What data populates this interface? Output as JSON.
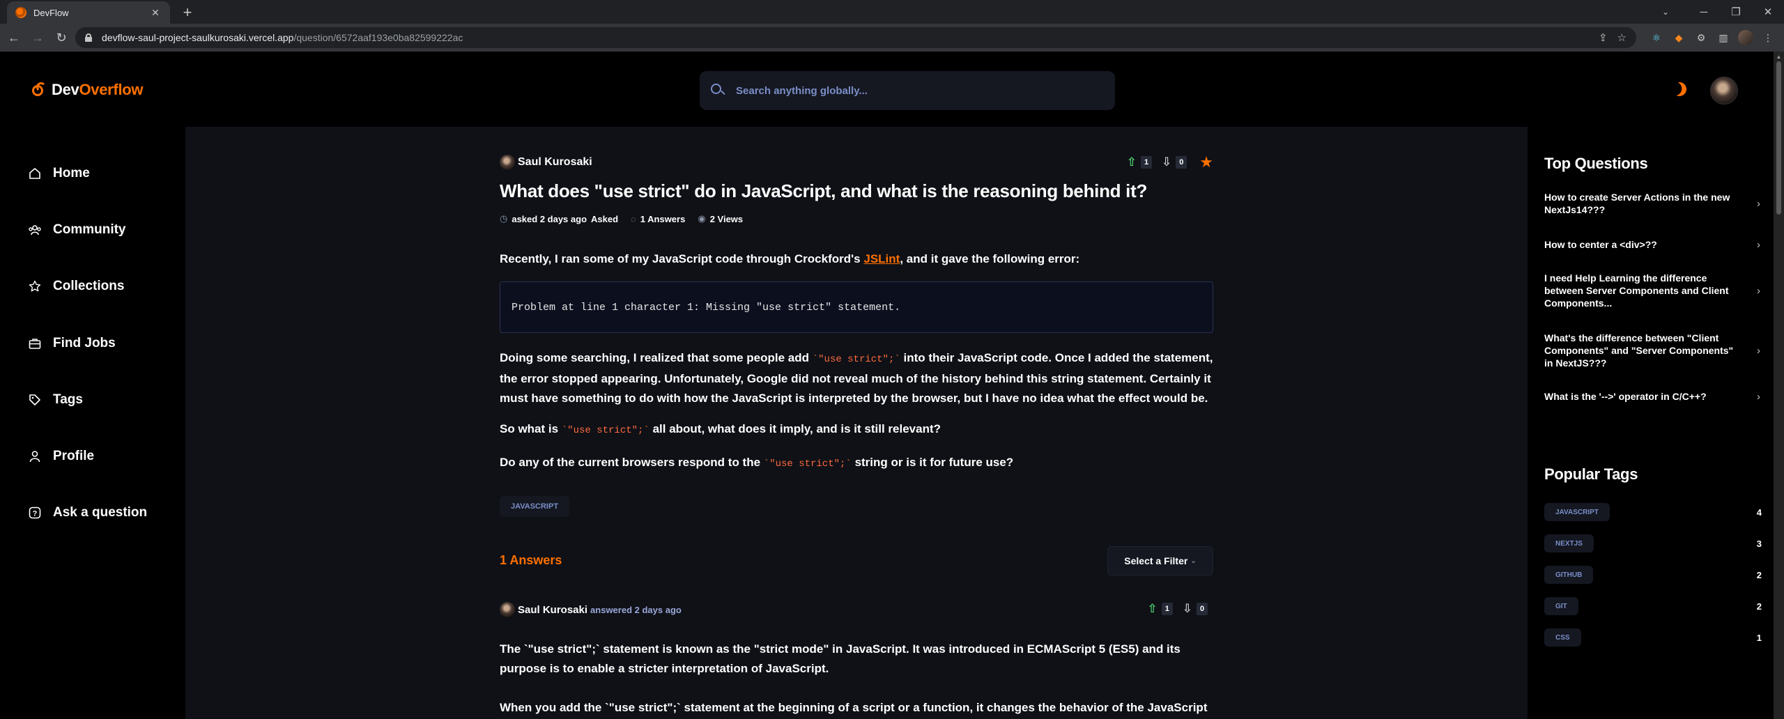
{
  "browser": {
    "tab_title": "DevFlow",
    "url_host": "devflow-saul-project-saulkurosaki.vercel.app",
    "url_path": "/question/6572aaf193e0ba82599222ac"
  },
  "header": {
    "logo_dev": "Dev",
    "logo_overflow": "Overflow",
    "search_placeholder": "Search anything globally..."
  },
  "sidebar": {
    "items": [
      {
        "label": "Home",
        "icon": "home-icon"
      },
      {
        "label": "Community",
        "icon": "users-icon"
      },
      {
        "label": "Collections",
        "icon": "star-icon"
      },
      {
        "label": "Find Jobs",
        "icon": "suitcase-icon"
      },
      {
        "label": "Tags",
        "icon": "tag-icon"
      },
      {
        "label": "Profile",
        "icon": "user-icon"
      },
      {
        "label": "Ask a question",
        "icon": "question-icon"
      }
    ]
  },
  "question": {
    "author": "Saul Kurosaki",
    "upvotes": "1",
    "downvotes": "0",
    "title": "What does \"use strict\" do in JavaScript, and what is the reasoning behind it?",
    "asked": "asked 2 days ago",
    "asked_label": "Asked",
    "answers": "1 Answers",
    "views": "2 Views",
    "p1_before": "Recently, I ran some of my JavaScript code through Crockford's",
    "p1_link": "JSLint",
    "p1_after": ", and it gave the following error:",
    "code_block": "Problem at line 1 character 1: Missing \"use strict\" statement.",
    "p2_before": "Doing some searching, I realized that some people add",
    "code_inline": "`\"use strict\";`",
    "p2_after": "into their JavaScript code. Once I added the statement, the error stopped appearing. Unfortunately, Google did not reveal much of the history behind this string statement. Certainly it must have something to do with how the JavaScript is interpreted by the browser, but I have no idea what the effect would be.",
    "p3_before": "So what is",
    "p3_after": "all about, what does it imply, and is it still relevant?",
    "p4_before": "Do any of the current browsers respond to the",
    "p4_after": "string or is it for future use?",
    "tag": "JAVASCRIPT"
  },
  "answers_section": {
    "count_label": "1 Answers",
    "filter_label": "Select a Filter",
    "answer": {
      "author": "Saul Kurosaki",
      "meta": "answered 2 days ago",
      "upvotes": "1",
      "downvotes": "0",
      "p1": "The `\"use strict\";` statement is known as the \"strict mode\" in JavaScript. It was introduced in ECMAScript 5 (ES5) and its purpose is to enable a stricter interpretation of JavaScript.",
      "p2": "When you add the `\"use strict\";` statement at the beginning of a script or a function, it changes the behavior of the JavaScript"
    }
  },
  "right_sidebar": {
    "top_questions_title": "Top Questions",
    "top_questions": [
      "How to create Server Actions in the new NextJs14???",
      "How to center a <div>??",
      "I need Help Learning the difference between Server Components and Client Components...",
      "What's the difference between \"Client Components\" and \"Server Components\" in NextJS???",
      "What is the '-->' operator in C/C++?"
    ],
    "popular_tags_title": "Popular Tags",
    "popular_tags": [
      {
        "name": "JAVASCRIPT",
        "count": "4"
      },
      {
        "name": "NEXTJS",
        "count": "3"
      },
      {
        "name": "GITHUB",
        "count": "2"
      },
      {
        "name": "GIT",
        "count": "2"
      },
      {
        "name": "CSS",
        "count": "1"
      }
    ]
  },
  "colors": {
    "accent": "#ff7000",
    "background": "#0f1117",
    "panel": "#000000",
    "tag_text": "#7b8ec8"
  }
}
